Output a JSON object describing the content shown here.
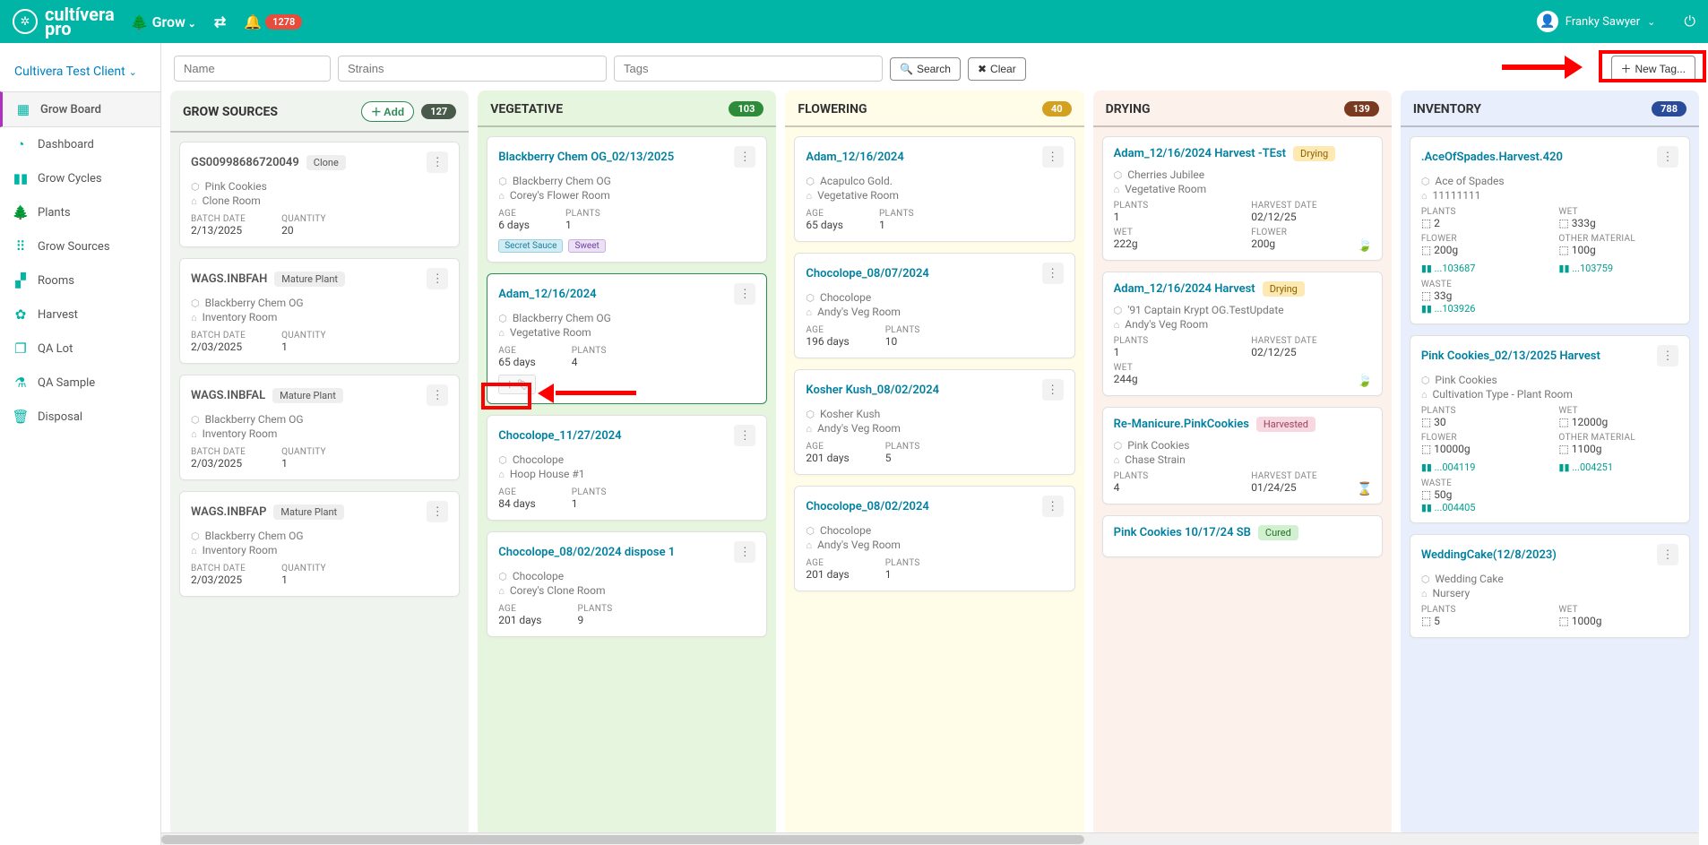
{
  "topbar": {
    "brand1": "cultívera",
    "brand2": "pro",
    "menu": "Grow",
    "notif": "1278",
    "user": "Franky Sawyer"
  },
  "client": "Cultivera Test Client",
  "nav": [
    {
      "label": "Grow Board",
      "icon": "▦"
    },
    {
      "label": "Dashboard",
      "icon": "◔"
    },
    {
      "label": "Grow Cycles",
      "icon": "▮▮"
    },
    {
      "label": "Plants",
      "icon": "🌲"
    },
    {
      "label": "Grow Sources",
      "icon": "⠿"
    },
    {
      "label": "Rooms",
      "icon": "▞"
    },
    {
      "label": "Harvest",
      "icon": "✿"
    },
    {
      "label": "QA Lot",
      "icon": "❐"
    },
    {
      "label": "QA Sample",
      "icon": "⚗"
    },
    {
      "label": "Disposal",
      "icon": "🗑"
    }
  ],
  "filters": {
    "name": "Name",
    "strains": "Strains",
    "tags": "Tags",
    "search": "Search",
    "clear": "Clear",
    "newtag": "New Tag..."
  },
  "columns": {
    "grow": {
      "title": "GROW SOURCES",
      "count": "127",
      "add": "Add"
    },
    "veg": {
      "title": "VEGETATIVE",
      "count": "103"
    },
    "flower": {
      "title": "FLOWERING",
      "count": "40"
    },
    "dry": {
      "title": "DRYING",
      "count": "139"
    },
    "inv": {
      "title": "INVENTORY",
      "count": "788"
    }
  },
  "grow_cards": [
    {
      "title": "GS00998686720049",
      "tag": "Clone",
      "strain": "Pink Cookies",
      "room": "Clone Room",
      "l1": "BATCH DATE",
      "v1": "2/13/2025",
      "l2": "QUANTITY",
      "v2": "20"
    },
    {
      "title": "WAGS.INBFAH",
      "tag": "Mature Plant",
      "strain": "Blackberry Chem OG",
      "room": "Inventory Room",
      "l1": "BATCH DATE",
      "v1": "2/03/2025",
      "l2": "QUANTITY",
      "v2": "1"
    },
    {
      "title": "WAGS.INBFAL",
      "tag": "Mature Plant",
      "strain": "Blackberry Chem OG",
      "room": "Inventory Room",
      "l1": "BATCH DATE",
      "v1": "2/03/2025",
      "l2": "QUANTITY",
      "v2": "1"
    },
    {
      "title": "WAGS.INBFAP",
      "tag": "Mature Plant",
      "strain": "Blackberry Chem OG",
      "room": "Inventory Room",
      "l1": "BATCH DATE",
      "v1": "2/03/2025",
      "l2": "QUANTITY",
      "v2": "1"
    }
  ],
  "veg_cards": [
    {
      "title": "Blackberry Chem OG_02/13/2025",
      "strain": "Blackberry Chem OG",
      "room": "Corey's Flower Room",
      "l1": "AGE",
      "v1": "6 days",
      "l2": "PLANTS",
      "v2": "1",
      "tags": [
        "Secret Sauce",
        "Sweet"
      ]
    },
    {
      "title": "Adam_12/16/2024",
      "strain": "Blackberry Chem OG",
      "room": "Vegetative Room",
      "l1": "AGE",
      "v1": "65 days",
      "l2": "PLANTS",
      "v2": "4",
      "selected": true,
      "addtag": true
    },
    {
      "title": "Chocolope_11/27/2024",
      "strain": "Chocolope",
      "room": "Hoop House #1",
      "l1": "AGE",
      "v1": "84 days",
      "l2": "PLANTS",
      "v2": "1"
    },
    {
      "title": "Chocolope_08/02/2024 dispose 1",
      "strain": "Chocolope",
      "room": "Corey's Clone Room",
      "l1": "AGE",
      "v1": "201 days",
      "l2": "PLANTS",
      "v2": "9"
    }
  ],
  "flower_cards": [
    {
      "title": "Adam_12/16/2024",
      "strain": "Acapulco Gold.",
      "room": "Vegetative Room",
      "l1": "AGE",
      "v1": "65 days",
      "l2": "PLANTS",
      "v2": "1"
    },
    {
      "title": "Chocolope_08/07/2024",
      "strain": "Chocolope",
      "room": "Andy's Veg Room",
      "l1": "AGE",
      "v1": "196 days",
      "l2": "PLANTS",
      "v2": "10"
    },
    {
      "title": "Kosher Kush_08/02/2024",
      "strain": "Kosher Kush",
      "room": "Andy's Veg Room",
      "l1": "AGE",
      "v1": "201 days",
      "l2": "PLANTS",
      "v2": "5"
    },
    {
      "title": "Chocolope_08/02/2024",
      "strain": "Chocolope",
      "room": "Andy's Veg Room",
      "l1": "AGE",
      "v1": "201 days",
      "l2": "PLANTS",
      "v2": "1"
    }
  ],
  "dry_cards": [
    {
      "title": "Adam_12/16/2024 Harvest -TEst",
      "tag": "Drying",
      "strain": "Cherries Jubilee",
      "room": "Vegetative Room",
      "grid": [
        [
          "PLANTS",
          "1"
        ],
        [
          "HARVEST DATE",
          "02/12/25"
        ],
        [
          "WET",
          "222g"
        ],
        [
          "FLOWER",
          "200g"
        ]
      ],
      "leaf": true
    },
    {
      "title": "Adam_12/16/2024 Harvest",
      "tag": "Drying",
      "strain": "'91 Captain Krypt OG.TestUpdate",
      "room": "Andy's Veg Room",
      "grid": [
        [
          "PLANTS",
          "1"
        ],
        [
          "HARVEST DATE",
          "02/12/25"
        ],
        [
          "WET",
          "244g"
        ],
        [
          "",
          ""
        ]
      ],
      "leaf": true
    },
    {
      "title": "Re-Manicure.PinkCookies",
      "tag": "Harvested",
      "tagc": "pink",
      "strain": "Pink Cookies",
      "room": "Chase Strain",
      "grid": [
        [
          "PLANTS",
          "4"
        ],
        [
          "HARVEST DATE",
          "01/24/25"
        ]
      ],
      "hourglass": true
    },
    {
      "title": "Pink Cookies 10/17/24 SB",
      "tag": "Cured",
      "tagc": "green"
    }
  ],
  "inv_cards": [
    {
      "title": ".AceOfSpades.Harvest.420",
      "strain": "Ace of Spades",
      "room": "11111111",
      "grid": [
        [
          "PLANTS",
          "2"
        ],
        [
          "WET",
          "333g"
        ],
        [
          "FLOWER",
          "200g"
        ],
        [
          "OTHER MATERIAL",
          "100g"
        ]
      ],
      "barcodes": [
        [
          "...103687",
          "...103759"
        ]
      ],
      "waste": "33g",
      "wbar": "...103926"
    },
    {
      "title": "Pink Cookies_02/13/2025 Harvest",
      "strain": "Pink Cookies",
      "room": "Cultivation Type - Plant Room",
      "grid": [
        [
          "PLANTS",
          "30"
        ],
        [
          "WET",
          "12000g"
        ],
        [
          "FLOWER",
          "10000g"
        ],
        [
          "OTHER MATERIAL",
          "1100g"
        ]
      ],
      "barcodes": [
        [
          "...004119",
          "...004251"
        ]
      ],
      "waste": "50g",
      "wbar": "...004405"
    },
    {
      "title": "WeddingCake(12/8/2023)",
      "strain": "Wedding Cake",
      "room": "Nursery",
      "grid": [
        [
          "PLANTS",
          "5"
        ],
        [
          "WET",
          "1000g"
        ]
      ]
    }
  ]
}
